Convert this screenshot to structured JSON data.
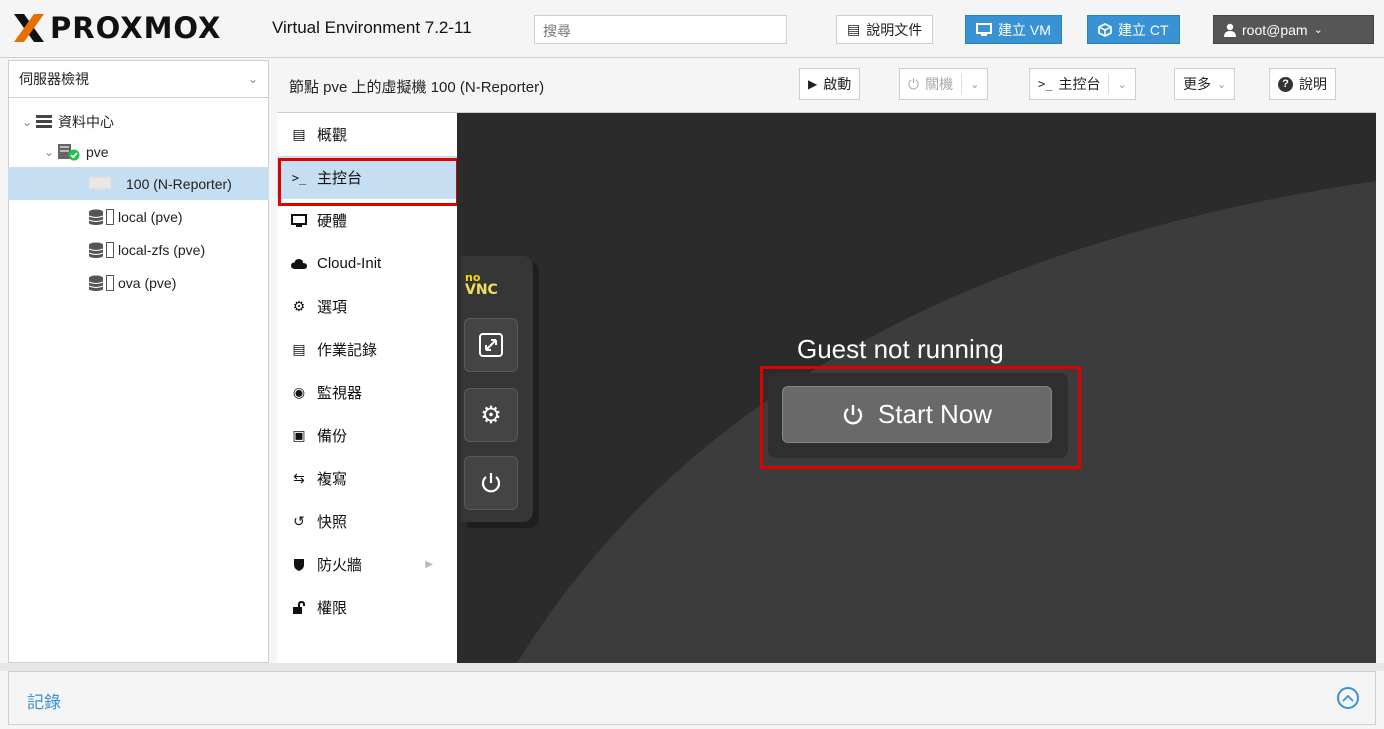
{
  "topbar": {
    "logo_text": "PROXMOX",
    "version": "Virtual Environment 7.2-11",
    "search_placeholder": "搜尋",
    "docs_label": "說明文件",
    "create_vm_label": "建立 VM",
    "create_ct_label": "建立 CT",
    "user_label": "root@pam"
  },
  "sidebar": {
    "view_label": "伺服器檢視",
    "tree": [
      {
        "label": "資料中心"
      },
      {
        "label": "pve"
      },
      {
        "label": "100 (N-Reporter)"
      },
      {
        "label": "local (pve)"
      },
      {
        "label": "local-zfs (pve)"
      },
      {
        "label": "ova (pve)"
      }
    ]
  },
  "header": {
    "title": "節點 pve 上的虛擬機 100 (N-Reporter)",
    "start_label": "啟動",
    "shutdown_label": "關機",
    "console_label": "主控台",
    "more_label": "更多",
    "help_label": "說明"
  },
  "nav": {
    "items": [
      {
        "label": "概觀",
        "icon": "book-icon"
      },
      {
        "label": "主控台",
        "icon": "terminal-icon"
      },
      {
        "label": "硬體",
        "icon": "monitor-icon"
      },
      {
        "label": "Cloud-Init",
        "icon": "cloud-icon"
      },
      {
        "label": "選項",
        "icon": "gear-icon"
      },
      {
        "label": "作業記錄",
        "icon": "list-icon"
      },
      {
        "label": "監視器",
        "icon": "eye-icon"
      },
      {
        "label": "備份",
        "icon": "floppy-icon"
      },
      {
        "label": "複寫",
        "icon": "retweet-icon"
      },
      {
        "label": "快照",
        "icon": "history-icon"
      },
      {
        "label": "防火牆",
        "icon": "shield-icon"
      },
      {
        "label": "權限",
        "icon": "unlock-icon"
      }
    ]
  },
  "console": {
    "vnc_logo_top": "no",
    "vnc_logo_bottom": "VNC",
    "status_text": "Guest not running",
    "start_button_label": "Start Now"
  },
  "log": {
    "title": "記錄"
  },
  "colors": {
    "accent": "#3892d4",
    "highlight": "#e00000",
    "brand_orange": "#e57000",
    "console_bg": "#3c3c3c"
  }
}
